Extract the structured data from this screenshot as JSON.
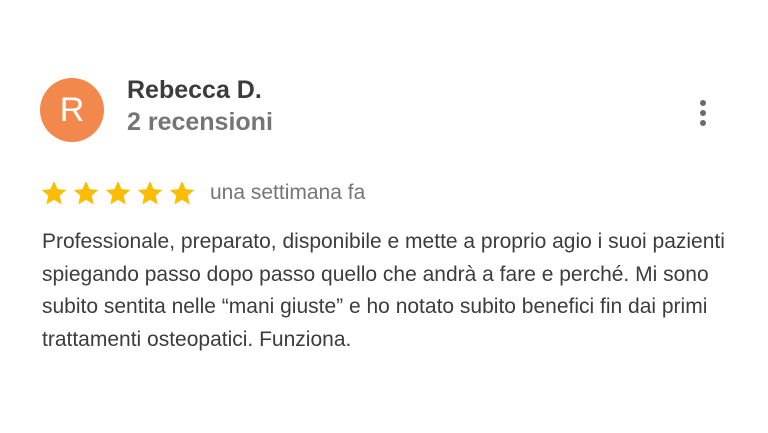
{
  "review": {
    "avatar_initial": "R",
    "author_name": "Rebecca D.",
    "review_count": "2 recensioni",
    "rating": 5,
    "max_rating": 5,
    "date": "una settimana fa",
    "text": "Professionale, preparato, disponibile e mette a proprio agio i suoi pazienti spiegando passo dopo passo quello che andrà a fare e perché. Mi sono subito sentita nelle “mani giuste” e ho notato subito benefici fin dai primi trattamenti osteopatici. Funziona."
  },
  "colors": {
    "avatar_bg": "#f2884b",
    "star": "#fbbc04",
    "name_text": "#3c3c3c",
    "secondary_text": "#757575"
  },
  "icons": {
    "menu": "more-vert-icon",
    "star": "star-icon"
  }
}
